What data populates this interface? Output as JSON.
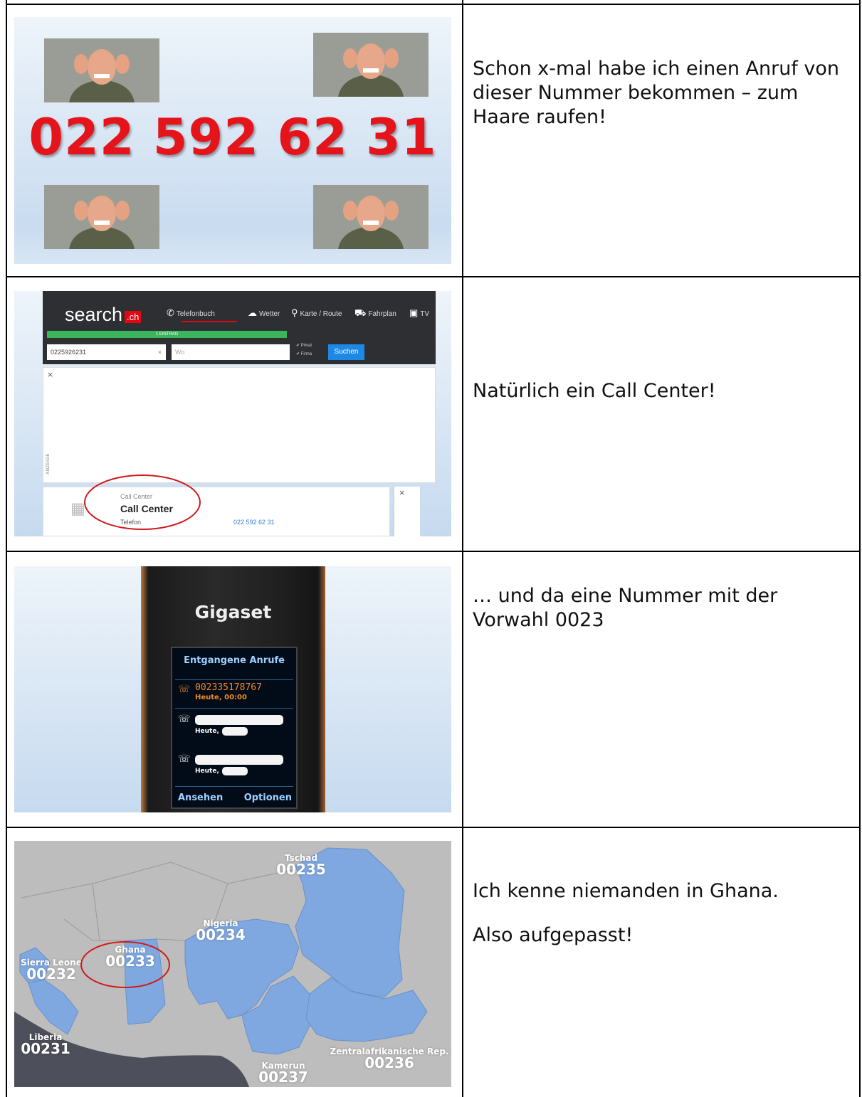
{
  "rows": [
    {
      "text_lines": [
        "Schon x-mal habe ich einen Anruf von dieser Nummer bekommen – zum Haare raufen!"
      ]
    },
    {
      "text_lines": [
        "Natürlich ein Call Center!"
      ]
    },
    {
      "text_lines": [
        "… und da eine Nummer mit der Vorwahl 0023"
      ]
    },
    {
      "text_lines": [
        "Ich kenne niemanden in Ghana.",
        "Also aufgepasst!"
      ]
    }
  ],
  "promo": {
    "phone_number": "022 592 62 31"
  },
  "search_site": {
    "logo_text": "search",
    "logo_badge": ".ch",
    "nav": [
      "Telefonbuch",
      "Wetter",
      "Karte / Route",
      "Fahrplan",
      "TV"
    ],
    "result_count": "1 EINTRAG",
    "query_value": "0225926231",
    "where_placeholder": "Wo",
    "check_private": "Privat",
    "check_company": "Firma",
    "search_button": "Suchen",
    "ad_label": "ANZEIGE",
    "result": {
      "category": "Call Center",
      "name": "Call Center",
      "type_label": "Telefon",
      "number": "022 592 62 31"
    }
  },
  "phone_display": {
    "brand": "Gigaset",
    "title": "Entgangene Anrufe",
    "entries": [
      {
        "number": "002335178767",
        "time": "Heute, 00:00"
      },
      {
        "number": "",
        "time": "Heute,"
      },
      {
        "number": "",
        "time": "Heute,"
      }
    ],
    "softkey_left": "Ansehen",
    "softkey_right": "Optionen"
  },
  "map": {
    "countries": [
      {
        "name": "Tschad",
        "code": "00235"
      },
      {
        "name": "Nigeria",
        "code": "00234"
      },
      {
        "name": "Ghana",
        "code": "00233"
      },
      {
        "name": "Sierra Leone",
        "code": "00232"
      },
      {
        "name": "Liberia",
        "code": "00231"
      },
      {
        "name": "Kamerun",
        "code": "00237"
      },
      {
        "name": "Zentralafrikanische Rep.",
        "code": "00236"
      }
    ],
    "colors": {
      "highlight": "#7fa8e0",
      "land": "#bdbdbd",
      "sea": "#4d4f5a",
      "circle": "#d01a1a"
    }
  }
}
